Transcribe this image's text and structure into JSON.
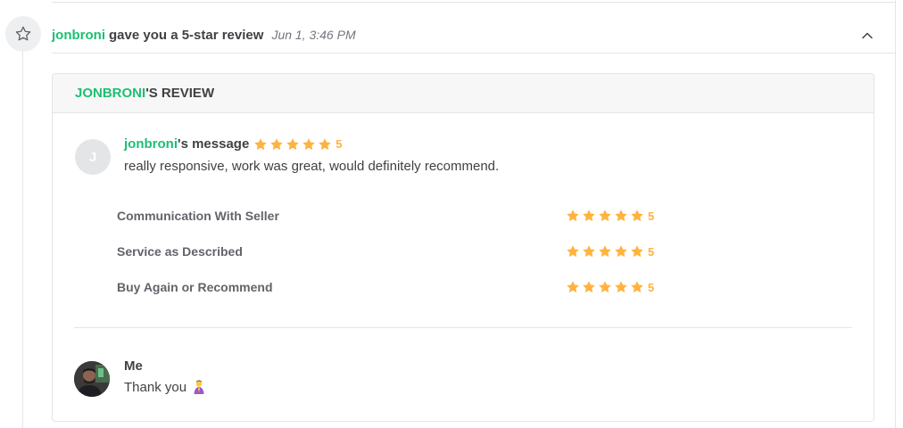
{
  "event": {
    "username": "jonbroni",
    "action": "gave you a 5-star review",
    "timestamp": "Jun 1, 3:46 PM"
  },
  "review_card": {
    "title_user": "JONBRONI",
    "title_suffix": "'S REVIEW",
    "avatar_initial": "J",
    "message_user": "jonbroni",
    "message_label": "'s message",
    "overall_score": "5",
    "message_text": "really responsive, work was great, would definitely recommend.",
    "ratings": [
      {
        "label": "Communication With Seller",
        "score": "5"
      },
      {
        "label": "Service as Described",
        "score": "5"
      },
      {
        "label": "Buy Again or Recommend",
        "score": "5"
      }
    ]
  },
  "reply": {
    "name": "Me",
    "text": "Thank you",
    "emoji_icon": "person-bowing-icon"
  },
  "colors": {
    "accent_green": "#1dbf73",
    "star_orange": "#ffb33e",
    "text_dark": "#404145",
    "border": "#e4e5e7"
  }
}
